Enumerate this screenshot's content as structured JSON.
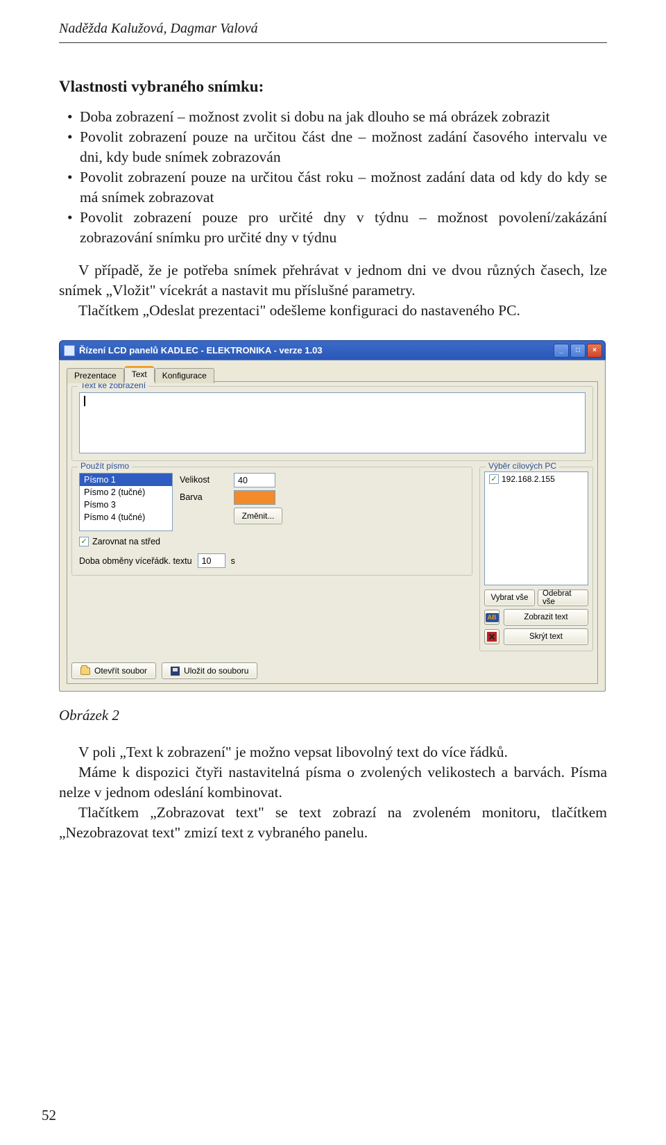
{
  "authors": "Naděžda Kalužová, Dagmar Valová",
  "heading": "Vlastnosti vybraného snímku:",
  "bullets": [
    "Doba zobrazení – možnost zvolit si dobu na jak dlouho se má obrázek zobrazit",
    "Povolit zobrazení pouze na určitou část dne – možnost zadání časového intervalu ve dni, kdy bude snímek zobrazován",
    "Povolit zobrazení pouze na určitou část roku – možnost zadání data od kdy do kdy se má snímek zobrazovat",
    "Povolit zobrazení pouze pro určité dny v týdnu – možnost povolení/zakázání zobrazování snímku pro určité dny v týdnu"
  ],
  "para1": "V případě, že je potřeba snímek přehrávat v jednom dni ve dvou různých časech, lze snímek „Vložit\" vícekrát a nastavit mu příslušné parametry.",
  "para2": "Tlačítkem „Odeslat prezentaci\" odešleme konfiguraci do nastaveného PC.",
  "figure_caption": "Obrázek 2",
  "para3": "V poli „Text k zobrazení\" je možno vepsat libovolný text do více řádků.",
  "para4": "Máme k dispozici čtyři nastitelná písma o zvolených velikostech a barvách. Písma nelze v jednom odeslání kombinovat.",
  "para4_full": "Máme k dispozici čtyři nastavitelná písma o zvolených velikostech a barvách. Písma nelze v jednom odeslání kombinovat.",
  "para5": "Tlačítkem „Zobrazovat text\" se text zobrazí na zvoleném monitoru, tlačítkem „Nezobrazovat text\" zmizí text z vybraného panelu.",
  "page_number": "52",
  "app": {
    "title": "Řízení LCD panelů KADLEC - ELEKTRONIKA  - verze 1.03",
    "tabs": {
      "t0": "Prezentace",
      "t1": "Text",
      "t2": "Konfigurace"
    },
    "group_text": "Text ke zobrazení",
    "group_font": "Použít písmo",
    "fonts": {
      "f0": "Písmo 1",
      "f1": "Písmo 2 (tučné)",
      "f2": "Písmo 3",
      "f3": "Písmo 4 (tučné)"
    },
    "lbl_size": "Velikost",
    "val_size": "40",
    "lbl_color": "Barva",
    "btn_change": "Změnit...",
    "chk_center": "Zarovnat na střed",
    "lbl_swap": "Doba obměny víceřádk. textu",
    "val_swap": "10",
    "unit_s": "s",
    "group_pc": "Výběr cílových PC",
    "pc0": "192.168.2.155",
    "btn_select_all": "Vybrat vše",
    "btn_remove_all": "Odebrat vše",
    "btn_show_text": "Zobrazit text",
    "btn_hide_text": "Skrýt text",
    "btn_open": "Otevřít soubor",
    "btn_save": "Uložit do souboru",
    "ab_label": "AB"
  }
}
